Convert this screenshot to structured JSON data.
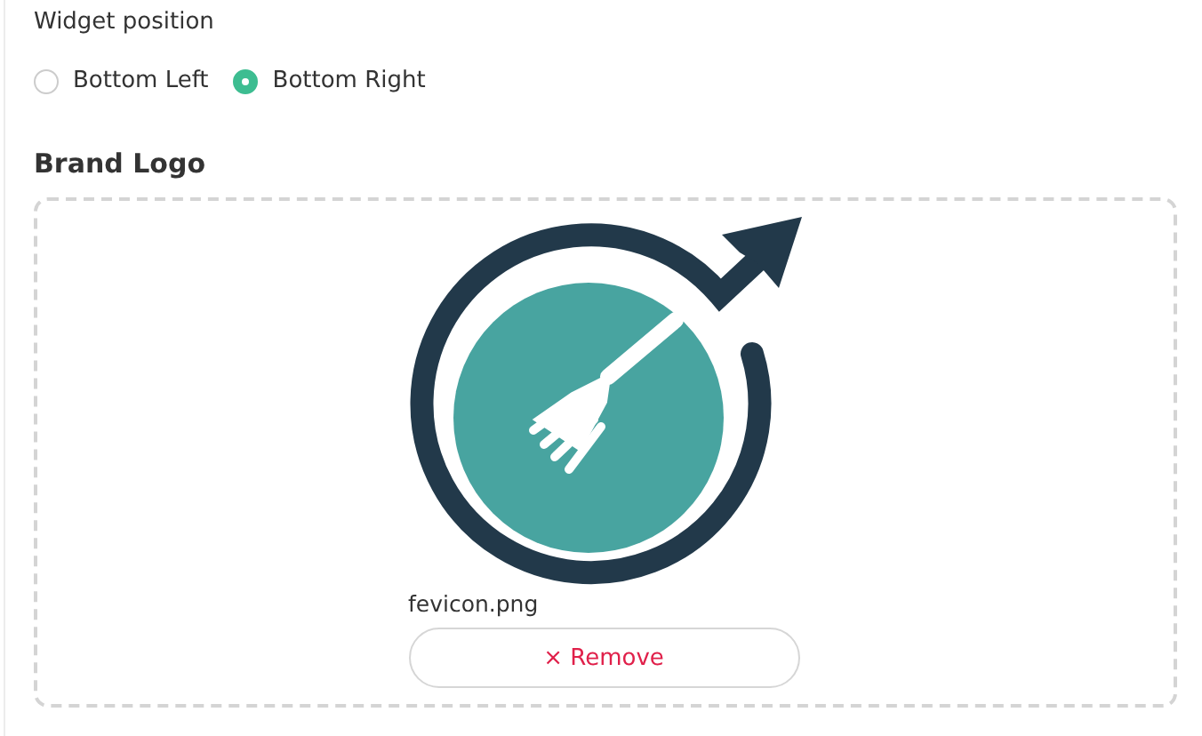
{
  "widget_position": {
    "label": "Widget position",
    "options": [
      {
        "label": "Bottom Left",
        "selected": false
      },
      {
        "label": "Bottom Right",
        "selected": true
      }
    ]
  },
  "brand_logo": {
    "title": "Brand Logo",
    "filename": "fevicon.png",
    "remove_button": "× Remove"
  }
}
